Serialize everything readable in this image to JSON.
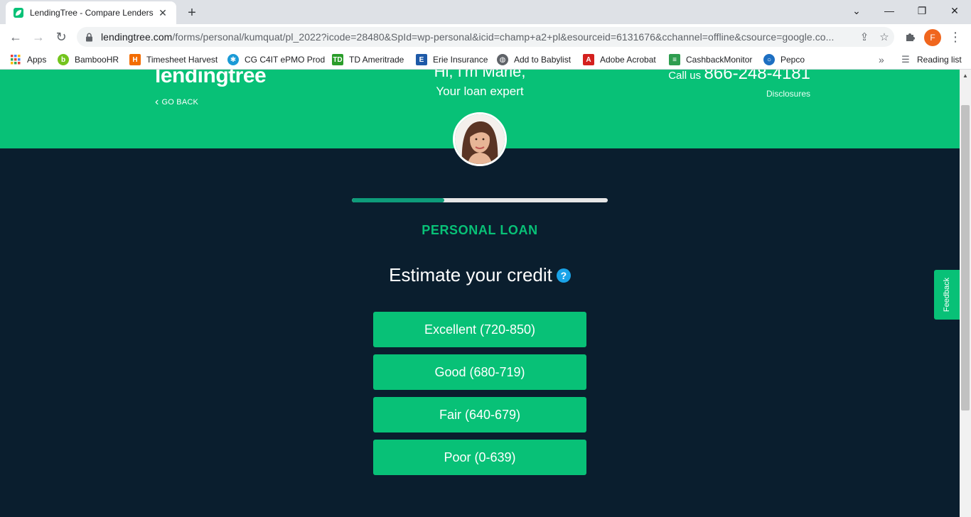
{
  "browser": {
    "tab_title": "LendingTree - Compare Lenders",
    "url_host": "lendingtree.com",
    "url_path": "/forms/personal/kumquat/pl_2022?icode=28480&SpId=wp-personal&icid=champ+a2+pl&esourceid=6131676&cchannel=offline&csource=google.co...",
    "profile_initial": "F",
    "bookmarks": [
      {
        "label": "Apps",
        "icon": "apps-grid-icon"
      },
      {
        "label": "BambooHR",
        "icon": "bamboohr-icon"
      },
      {
        "label": "Timesheet Harvest",
        "icon": "harvest-icon"
      },
      {
        "label": "CG C4IT ePMO Prod",
        "icon": "cg-icon"
      },
      {
        "label": "TD Ameritrade",
        "icon": "td-icon"
      },
      {
        "label": "Erie Insurance",
        "icon": "erie-icon"
      },
      {
        "label": "Add to Babylist",
        "icon": "globe-icon"
      },
      {
        "label": "Adobe Acrobat",
        "icon": "acrobat-icon"
      },
      {
        "label": "CashbackMonitor",
        "icon": "cashback-icon"
      },
      {
        "label": "Pepco",
        "icon": "pepco-icon"
      }
    ],
    "reading_list": "Reading list"
  },
  "header": {
    "logo": "lendingtree",
    "go_back": "GO BACK",
    "greeting": "Hi, I'm Marie,",
    "subtitle": "Your loan expert",
    "call_label": "Call us",
    "phone": "866-248-4181",
    "disclosures": "Disclosures"
  },
  "progress": {
    "value": 0.36
  },
  "form": {
    "section_label": "PERSONAL LOAN",
    "question": "Estimate your credit",
    "options": [
      "Excellent (720-850)",
      "Good (680-719)",
      "Fair (640-679)",
      "Poor (0-639)"
    ]
  },
  "feedback": "Feedback",
  "colors": {
    "brand_green": "#08c177",
    "page_bg": "#0a1e2e",
    "progress_fill": "#0e9c7a",
    "help_blue": "#1aa3e8"
  }
}
